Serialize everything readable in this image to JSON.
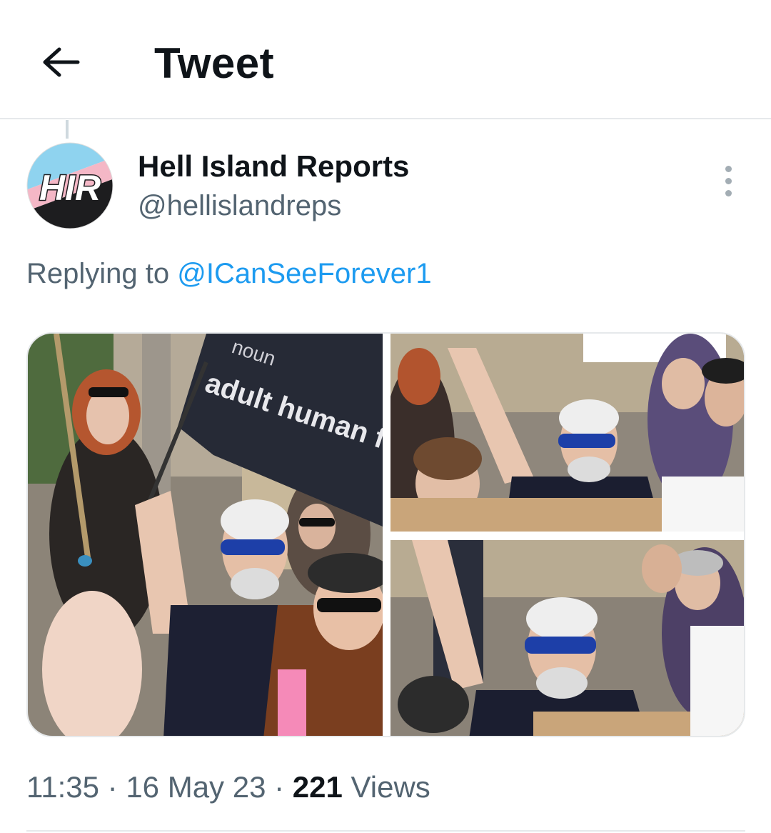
{
  "header": {
    "title": "Tweet",
    "back_icon": "arrow-left-icon"
  },
  "tweet": {
    "author": {
      "name": "Hell Island Reports",
      "handle": "@hellislandreps",
      "avatar_text": "HIR"
    },
    "replying_prefix": "Replying to",
    "replying_to": "@ICanSeeForever1",
    "media": [
      {
        "alt": "Protester with white hair and blue sunglasses waving a black flag"
      },
      {
        "alt": "Same protester raising a flag in a crowd"
      },
      {
        "alt": "Close-up of protester with raised arm"
      }
    ],
    "flag_text": "adult human f",
    "flag_text_top": "noun",
    "time": "11:35",
    "date": "16 May 23",
    "views_count": "221",
    "views_label": "Views"
  },
  "colors": {
    "link": "#1d9bf0",
    "secondary_text": "#536471",
    "divider": "#e6e9eb"
  }
}
